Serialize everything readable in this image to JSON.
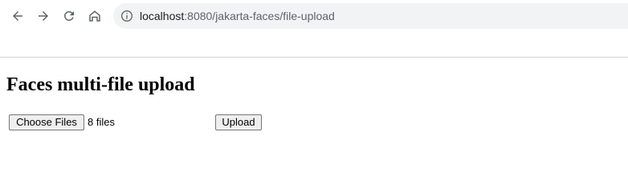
{
  "browser": {
    "url_host": "localhost",
    "url_rest": ":8080/jakarta-faces/file-upload"
  },
  "page": {
    "title": "Faces multi-file upload",
    "choose_label": "Choose Files",
    "files_status": "8 files",
    "upload_label": "Upload"
  }
}
